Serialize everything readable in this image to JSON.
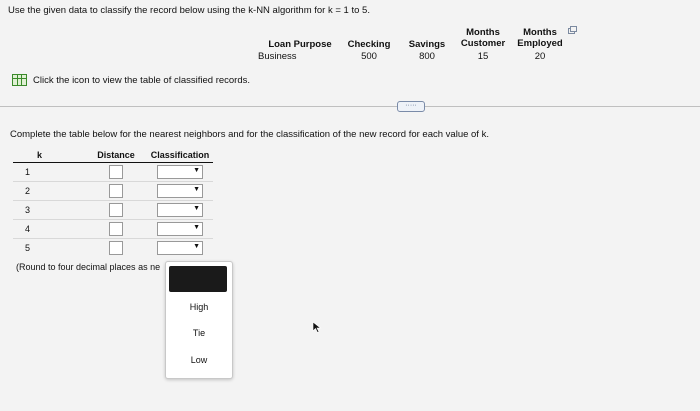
{
  "question": "Use the given data to classify the record below using the k-NN algorithm for k = 1 to 5.",
  "record": {
    "headers": {
      "loan_purpose": "Loan Purpose",
      "checking": "Checking",
      "savings": "Savings",
      "months_customer": "Months Customer",
      "months_employed": "Months Employed"
    },
    "values": {
      "loan_purpose": "Business",
      "checking": "500",
      "savings": "800",
      "months_customer": "15",
      "months_employed": "20"
    }
  },
  "table_link": "Click the icon to view the table of classified records.",
  "more_button": "·····",
  "instruction": "Complete the table below for the nearest neighbors and for the classification of the new record for each value of k.",
  "table": {
    "headers": [
      "k",
      "Distance",
      "Classification"
    ],
    "rows": [
      {
        "k": "1"
      },
      {
        "k": "2"
      },
      {
        "k": "3"
      },
      {
        "k": "4"
      },
      {
        "k": "5"
      }
    ]
  },
  "round_note": "(Round to four decimal places as ne",
  "dropdown": {
    "options": [
      "High",
      "Tie",
      "Low"
    ]
  }
}
